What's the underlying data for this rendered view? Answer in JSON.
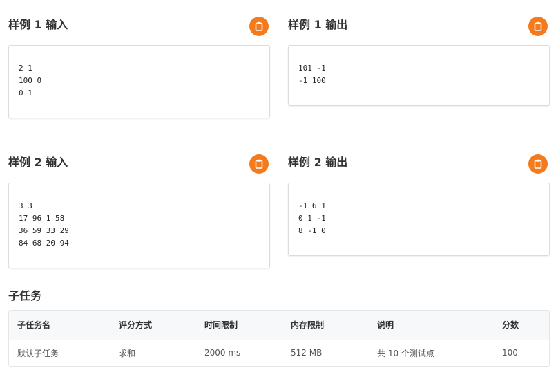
{
  "samples": [
    {
      "title": "样例 1 输入",
      "lines": "2 1\n100 0\n0 1"
    },
    {
      "title": "样例 1 输出",
      "lines": "101 -1\n-1 100"
    },
    {
      "title": "样例 2 输入",
      "lines": "3 3\n17 96 1 58\n36 59 33 29\n84 68 20 94"
    },
    {
      "title": "样例 2 输出",
      "lines": "-1 6 1\n0 1 -1\n8 -1 0"
    }
  ],
  "subtasks": {
    "title": "子任务",
    "headers": [
      "子任务名",
      "评分方式",
      "时间限制",
      "内存限制",
      "说明",
      "分数"
    ],
    "rows": [
      [
        "默认子任务",
        "求和",
        "2000 ms",
        "512 MB",
        "共 10 个测试点",
        "100"
      ]
    ]
  },
  "colors": {
    "accent": "#f37b1d"
  },
  "icons": {
    "copy": "clipboard-icon"
  }
}
